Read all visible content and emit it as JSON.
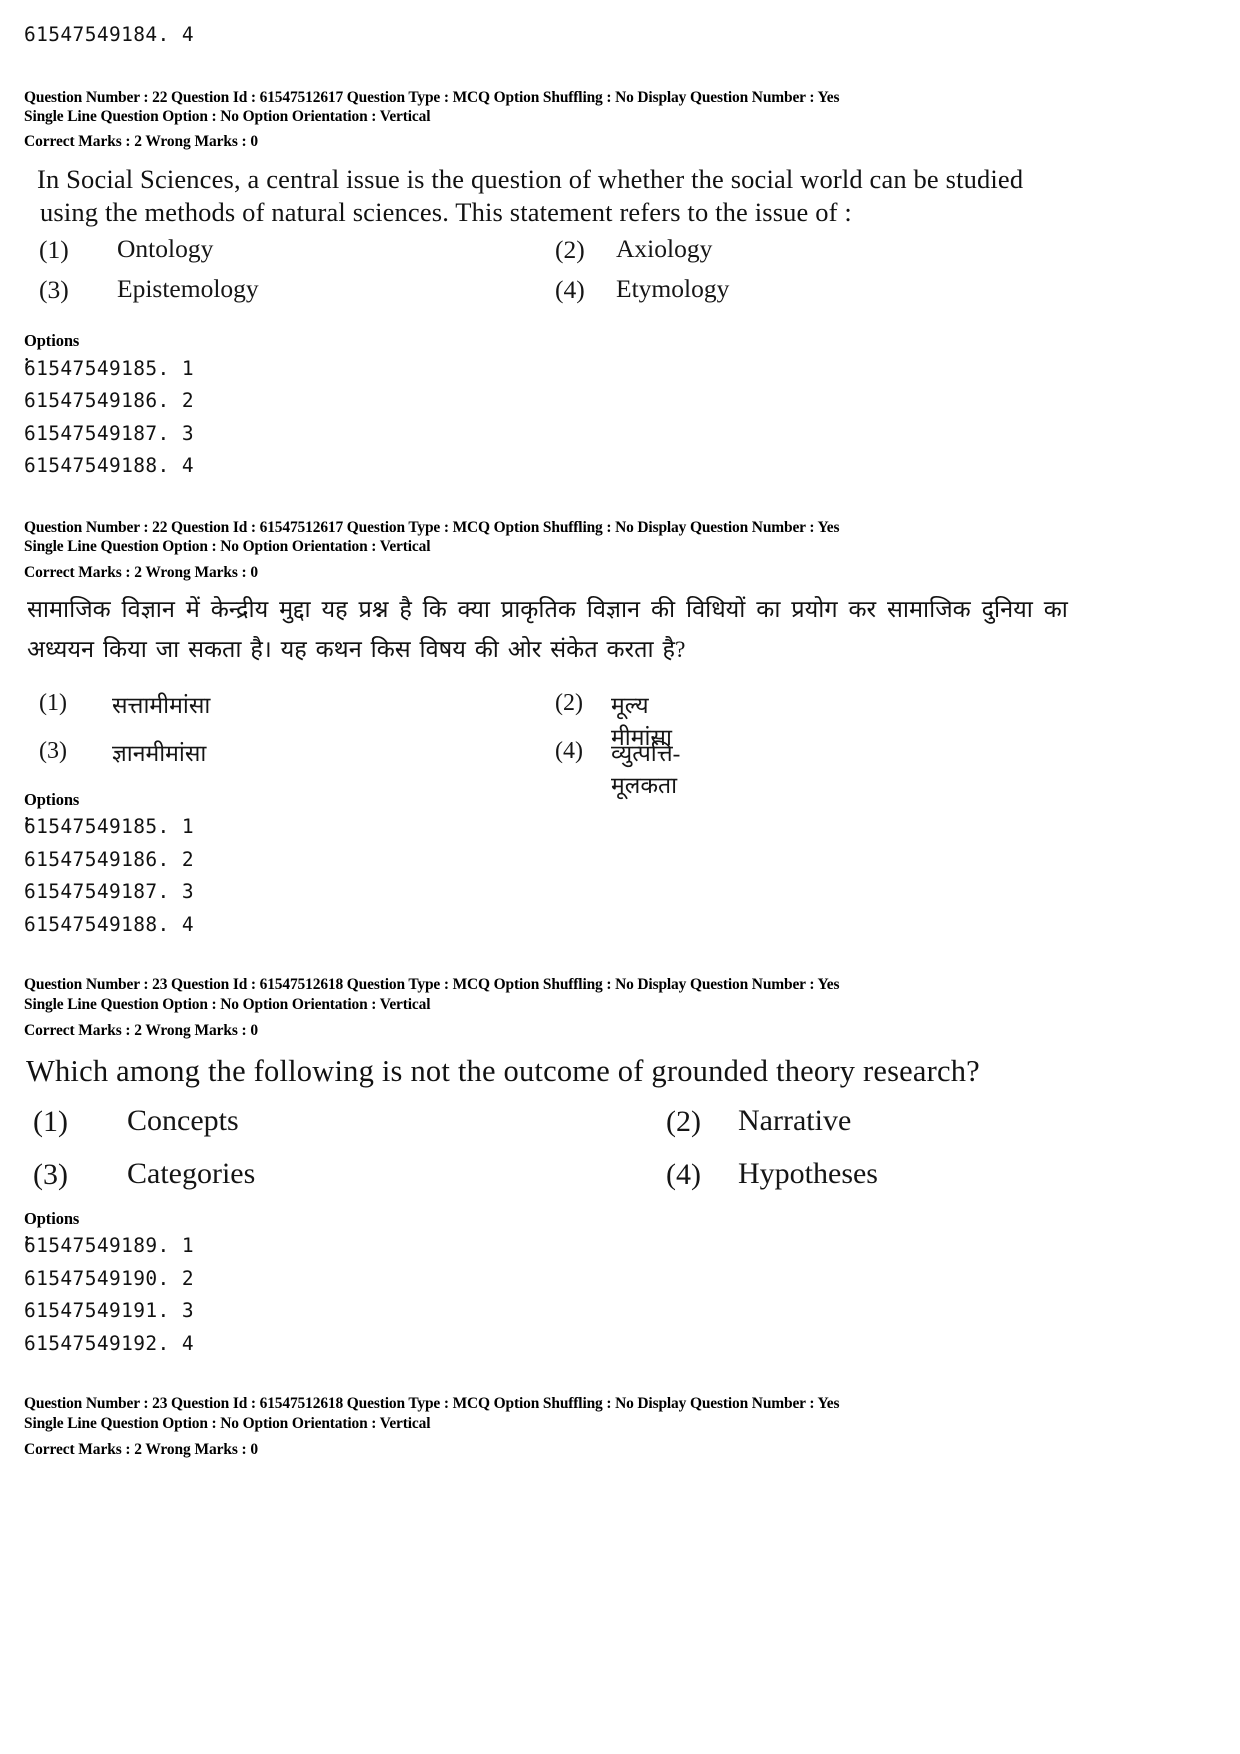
{
  "page": {
    "top_option_id": "61547549184. 4",
    "options_caption": "Options :"
  },
  "questions": [
    {
      "id": "q22-en",
      "meta_line1": "Question Number : 22  Question Id : 61547512617  Question Type : MCQ  Option Shuffling : No  Display Question Number : Yes",
      "meta_line2": "Single Line Question Option : No  Option Orientation : Vertical",
      "meta_marks": "Correct Marks : 2  Wrong Marks : 0",
      "body_line1": "In Social Sciences, a central issue is the question of whether the social world can be studied",
      "body_line2": "using the methods of natural sciences. This statement refers to the issue of :",
      "options": [
        {
          "num": "(1)",
          "label": "Ontology"
        },
        {
          "num": "(2)",
          "label": "Axiology"
        },
        {
          "num": "(3)",
          "label": "Epistemology"
        },
        {
          "num": "(4)",
          "label": "Etymology"
        }
      ],
      "option_ids": [
        "61547549185. 1",
        "61547549186. 2",
        "61547549187. 3",
        "61547549188. 4"
      ]
    },
    {
      "id": "q22-hi",
      "meta_line1": "Question Number : 22  Question Id : 61547512617  Question Type : MCQ  Option Shuffling : No  Display Question Number : Yes",
      "meta_line2": "Single Line Question Option : No  Option Orientation : Vertical",
      "meta_marks": "Correct Marks : 2  Wrong Marks : 0",
      "body_line1": "सामाजिक विज्ञान में केन्द्रीय मुद्दा यह प्रश्न है कि क्या प्राकृतिक विज्ञान की विधियों का प्रयोग कर सामाजिक दुनिया का",
      "body_line2": "अध्ययन किया जा सकता है। यह कथन किस विषय की ओर संकेत करता है?",
      "options": [
        {
          "num": "(1)",
          "label": "सत्तामीमांसा"
        },
        {
          "num": "(2)",
          "label": "मूल्य मीमांसा"
        },
        {
          "num": "(3)",
          "label": "ज्ञानमीमांसा"
        },
        {
          "num": "(4)",
          "label": "व्युत्पत्ति-मूलकता"
        }
      ],
      "option_ids": [
        "61547549185. 1",
        "61547549186. 2",
        "61547549187. 3",
        "61547549188. 4"
      ]
    },
    {
      "id": "q23-en",
      "meta_line1": "Question Number : 23  Question Id : 61547512618  Question Type : MCQ  Option Shuffling : No  Display Question Number : Yes",
      "meta_line2": "Single Line Question Option : No  Option Orientation : Vertical",
      "meta_marks": "Correct Marks : 2  Wrong Marks : 0",
      "body_line1": "Which among the following is not the outcome of grounded theory research?",
      "options": [
        {
          "num": "(1)",
          "label": "Concepts"
        },
        {
          "num": "(2)",
          "label": "Narrative"
        },
        {
          "num": "(3)",
          "label": "Categories"
        },
        {
          "num": "(4)",
          "label": "Hypotheses"
        }
      ],
      "option_ids": [
        "61547549189. 1",
        "61547549190. 2",
        "61547549191. 3",
        "61547549192. 4"
      ]
    },
    {
      "id": "q23-hi",
      "meta_line1": "Question Number : 23  Question Id : 61547512618  Question Type : MCQ  Option Shuffling : No  Display Question Number : Yes",
      "meta_line2": "Single Line Question Option : No  Option Orientation : Vertical",
      "meta_marks": "Correct Marks : 2  Wrong Marks : 0"
    }
  ]
}
